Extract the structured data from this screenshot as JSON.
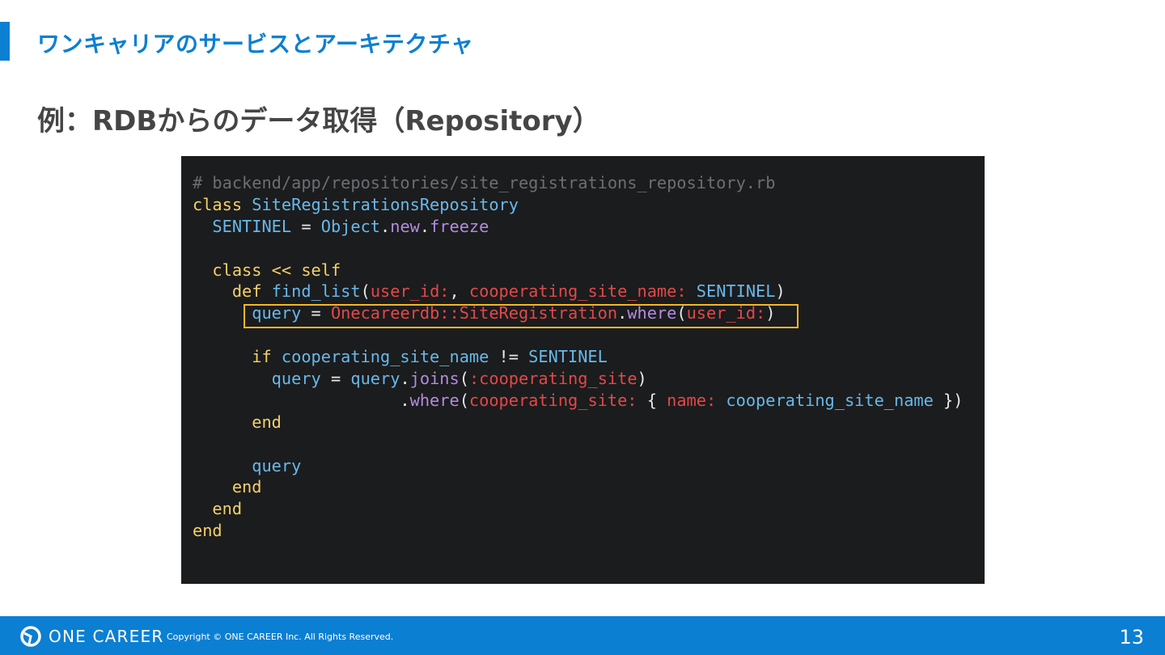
{
  "header": {
    "section_title": "ワンキャリアのサービスとアーキテクチャ",
    "slide_title": "例：RDBからのデータ取得（Repository）"
  },
  "code": {
    "lines": [
      [
        {
          "t": "# backend/app/repositories/site_registrations_repository.rb",
          "k": "comment"
        }
      ],
      [
        {
          "t": "class ",
          "k": "keyword"
        },
        {
          "t": "SiteRegistrationsRepository",
          "k": "const"
        }
      ],
      [
        {
          "t": "  SENTINEL",
          "k": "const"
        },
        {
          "t": " = ",
          "k": "plain"
        },
        {
          "t": "Object",
          "k": "const"
        },
        {
          "t": ".",
          "k": "plain"
        },
        {
          "t": "new",
          "k": "method"
        },
        {
          "t": ".",
          "k": "plain"
        },
        {
          "t": "freeze",
          "k": "method"
        }
      ],
      [],
      [
        {
          "t": "  class << self",
          "k": "keyword"
        }
      ],
      [
        {
          "t": "    def ",
          "k": "keyword"
        },
        {
          "t": "find_list",
          "k": "const"
        },
        {
          "t": "(",
          "k": "plain"
        },
        {
          "t": "user_id:",
          "k": "symbol"
        },
        {
          "t": ", ",
          "k": "plain"
        },
        {
          "t": "cooperating_site_name:",
          "k": "symbol"
        },
        {
          "t": " ",
          "k": "plain"
        },
        {
          "t": "SENTINEL",
          "k": "const"
        },
        {
          "t": ")",
          "k": "plain"
        }
      ],
      [
        {
          "t": "      query",
          "k": "ident"
        },
        {
          "t": " = ",
          "k": "plain"
        },
        {
          "t": "Onecareerdb::SiteRegistration",
          "k": "symbol"
        },
        {
          "t": ".",
          "k": "plain"
        },
        {
          "t": "where",
          "k": "method"
        },
        {
          "t": "(",
          "k": "plain"
        },
        {
          "t": "user_id:",
          "k": "symbol"
        },
        {
          "t": ")",
          "k": "plain"
        }
      ],
      [],
      [
        {
          "t": "      if ",
          "k": "keyword"
        },
        {
          "t": "cooperating_site_name",
          "k": "ident"
        },
        {
          "t": " != ",
          "k": "plain"
        },
        {
          "t": "SENTINEL",
          "k": "const"
        }
      ],
      [
        {
          "t": "        query",
          "k": "ident"
        },
        {
          "t": " = ",
          "k": "plain"
        },
        {
          "t": "query",
          "k": "ident"
        },
        {
          "t": ".",
          "k": "plain"
        },
        {
          "t": "joins",
          "k": "method"
        },
        {
          "t": "(",
          "k": "plain"
        },
        {
          "t": ":cooperating_site",
          "k": "symbol"
        },
        {
          "t": ")",
          "k": "plain"
        }
      ],
      [
        {
          "t": "                     .",
          "k": "plain"
        },
        {
          "t": "where",
          "k": "method"
        },
        {
          "t": "(",
          "k": "plain"
        },
        {
          "t": "cooperating_site:",
          "k": "symbol"
        },
        {
          "t": " { ",
          "k": "plain"
        },
        {
          "t": "name:",
          "k": "symbol"
        },
        {
          "t": " ",
          "k": "plain"
        },
        {
          "t": "cooperating_site_name",
          "k": "ident"
        },
        {
          "t": " })",
          "k": "plain"
        }
      ],
      [
        {
          "t": "      end",
          "k": "keyword"
        }
      ],
      [],
      [
        {
          "t": "      query",
          "k": "ident"
        }
      ],
      [
        {
          "t": "    end",
          "k": "keyword"
        }
      ],
      [
        {
          "t": "  end",
          "k": "keyword"
        }
      ],
      [
        {
          "t": "end",
          "k": "keyword"
        }
      ]
    ],
    "highlight_line": 6
  },
  "colors": {
    "accent": "#0b7fd2",
    "highlight_border": "#f2b824",
    "code_background": "#1b1c1d"
  },
  "footer": {
    "logo_icon": "onecareer-logo-icon",
    "logo_text": "ONE CAREER",
    "copyright": "Copyright © ONE CAREER Inc. All Rights Reserved.",
    "page_number": "13"
  }
}
